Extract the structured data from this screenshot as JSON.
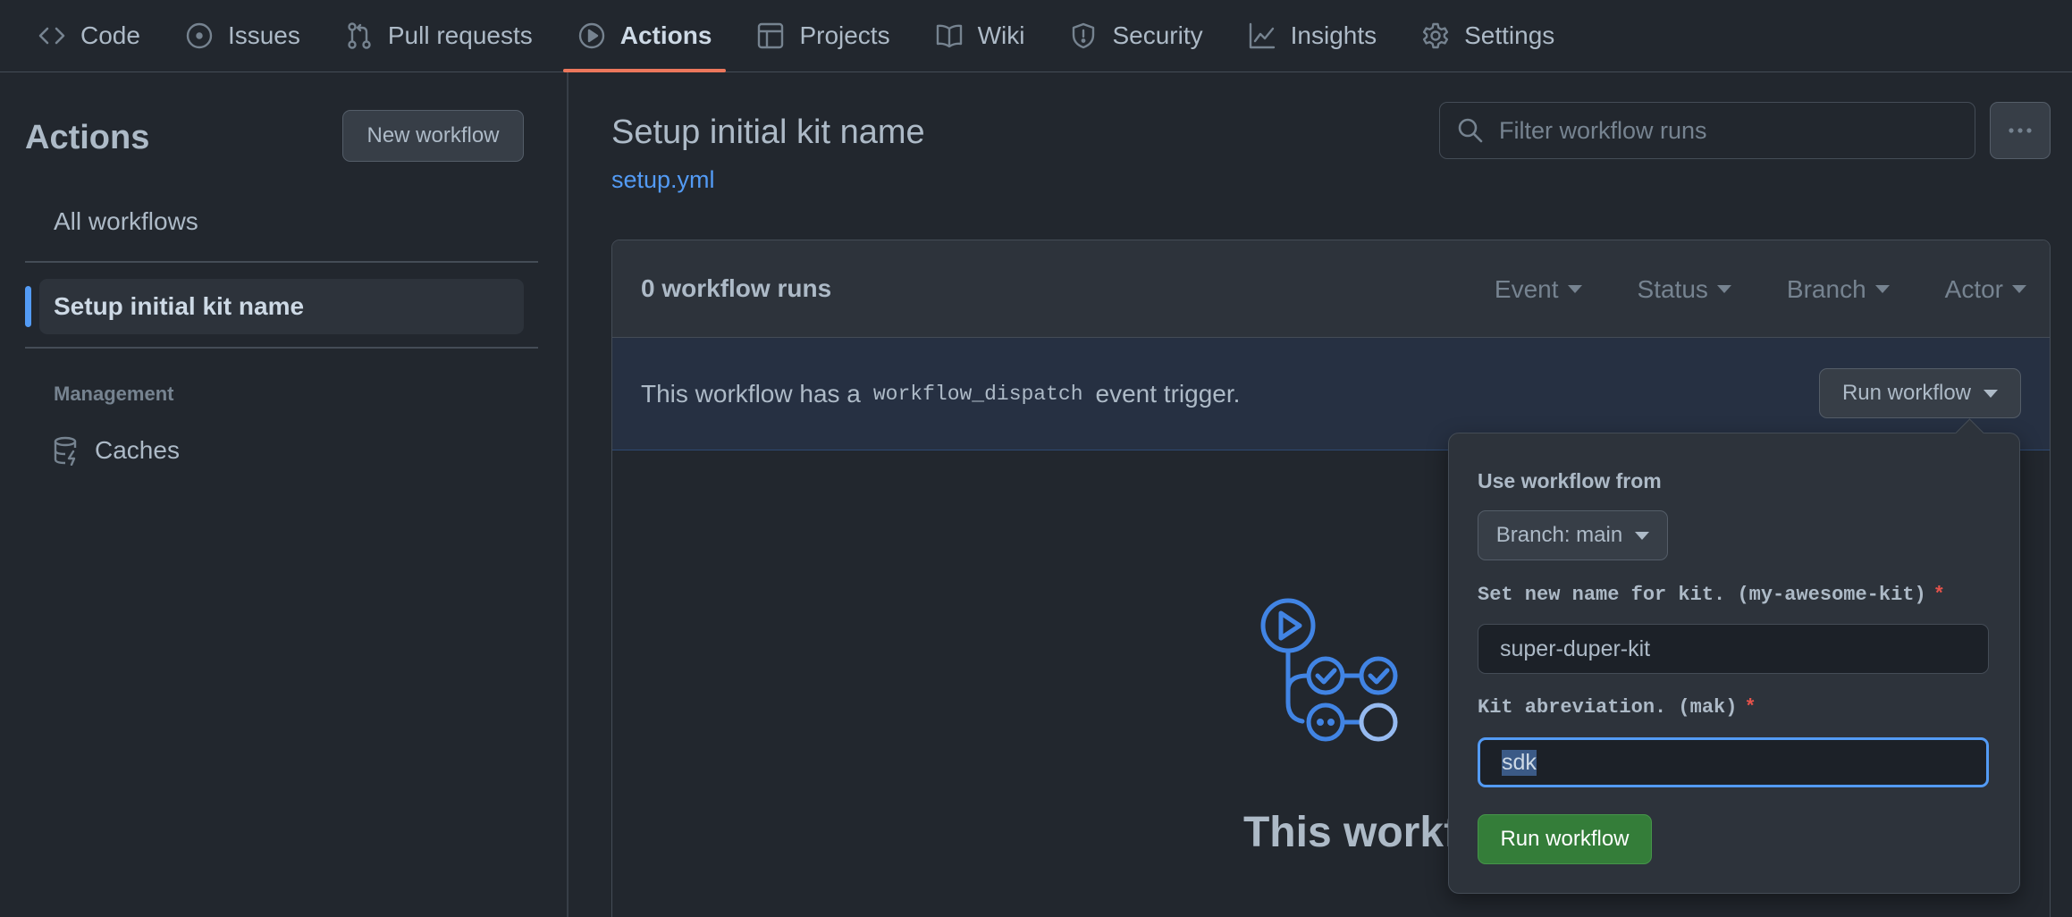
{
  "nav": {
    "tabs": [
      {
        "label": "Code",
        "icon": "code-icon"
      },
      {
        "label": "Issues",
        "icon": "issue-icon"
      },
      {
        "label": "Pull requests",
        "icon": "pull-request-icon"
      },
      {
        "label": "Actions",
        "icon": "play-icon",
        "active": true
      },
      {
        "label": "Projects",
        "icon": "table-icon"
      },
      {
        "label": "Wiki",
        "icon": "book-icon"
      },
      {
        "label": "Security",
        "icon": "shield-icon"
      },
      {
        "label": "Insights",
        "icon": "graph-icon"
      },
      {
        "label": "Settings",
        "icon": "gear-icon"
      }
    ],
    "active_color": "#ec775c"
  },
  "sidebar": {
    "title": "Actions",
    "new_workflow_label": "New workflow",
    "all_workflows_label": "All workflows",
    "selected_workflow_label": "Setup initial kit name",
    "management_heading": "Management",
    "caches_label": "Caches",
    "caches_icon": "database-icon"
  },
  "main": {
    "title": "Setup initial kit name",
    "file_link": "setup.yml",
    "filter_placeholder": "Filter workflow runs",
    "more_icon": "kebab-horizontal-icon",
    "runs_count": "0 workflow runs",
    "filters": [
      "Event",
      "Status",
      "Branch",
      "Actor"
    ],
    "dispatch": {
      "prefix": "This workflow has a",
      "code": "workflow_dispatch",
      "suffix": "event trigger.",
      "button_label": "Run workflow"
    },
    "empty_text": "This workflow has no"
  },
  "popover": {
    "use_from_label": "Use workflow from",
    "branch_label": "Branch: main",
    "field1_label": "Set new name for kit. (my-awesome-kit)",
    "field1_value": "super-duper-kit",
    "field2_label": "Kit abreviation. (mak)",
    "field2_value": "sdk",
    "required_mark": "*",
    "submit_label": "Run workflow"
  },
  "colors": {
    "background": "#22272e",
    "accent_blue": "#539bf5",
    "success_green": "#347d39",
    "danger_red": "#e5534b"
  }
}
